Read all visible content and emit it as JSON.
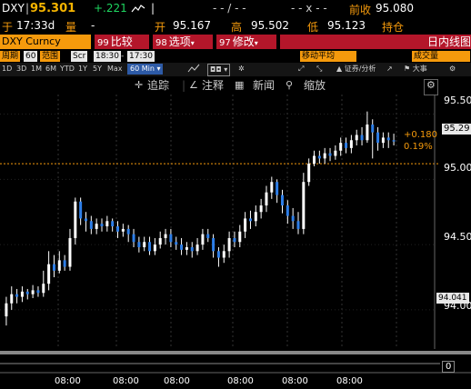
{
  "ticker": {
    "symbol": "DXY",
    "last": "95.301",
    "change": "+.221",
    "bid_ask": "- - / - -",
    "ask_x": "- -  x - -",
    "prev_close_label": "前收",
    "prev_close": "95.080",
    "time_label": "于",
    "time": "17:33d",
    "volume_label": "量",
    "volume": "-",
    "open_label": "开",
    "open": "95.167",
    "high_label": "高",
    "high": "95.502",
    "low_label": "低",
    "low": "95.123",
    "position_label": "持仓"
  },
  "function_bar": {
    "security": "DXY Curncy",
    "compare_num": "99",
    "compare": "比较",
    "options_num": "98",
    "options": "选项",
    "modify_num": "97",
    "modify": "修改",
    "chart_type": "日内线图"
  },
  "period_bar": {
    "period_label": "周期",
    "period_value": "60",
    "range_label": "范围",
    "scr": "Scr",
    "from_time": "18:30",
    "to_time": "17:30",
    "ma_label": "移动平均",
    "volume_label": "成交量"
  },
  "toolbar": {
    "ranges": [
      "1D",
      "3D",
      "1M",
      "6M",
      "YTD",
      "1Y",
      "5Y",
      "Max"
    ],
    "interval": "60 Min",
    "securities_label": "证券/分析",
    "events_label": "大事"
  },
  "annotations": {
    "trend": "追踪",
    "note": "注释",
    "news": "新闻",
    "zoom": "缩放"
  },
  "chart_data": {
    "type": "candlestick",
    "y_ticks": [
      "95.50",
      "95.00",
      "94.50",
      "94.00"
    ],
    "ylim": [
      93.7,
      95.65
    ],
    "x_ticks": [
      "08:00",
      "08:00",
      "08:00",
      "08:00",
      "08:00",
      "08:00"
    ],
    "last_price": "95.29",
    "change_abs": "+0.180",
    "change_pct": "0.19%",
    "prev_close_line": 95.12,
    "low_marker": "94.041",
    "volume_panel_value": "0",
    "candles": [
      [
        93.95,
        94.05,
        93.88,
        94.1
      ],
      [
        94.05,
        94.12,
        94.0,
        94.18
      ],
      [
        94.12,
        94.1,
        94.05,
        94.16
      ],
      [
        94.1,
        94.14,
        94.06,
        94.18
      ],
      [
        94.14,
        94.12,
        94.08,
        94.16
      ],
      [
        94.12,
        94.15,
        94.09,
        94.19
      ],
      [
        94.15,
        94.13,
        94.1,
        94.18
      ],
      [
        94.13,
        94.2,
        94.1,
        94.3
      ],
      [
        94.2,
        94.35,
        94.15,
        94.45
      ],
      [
        94.35,
        94.3,
        94.25,
        94.42
      ],
      [
        94.3,
        94.38,
        94.28,
        94.45
      ],
      [
        94.38,
        94.33,
        94.3,
        94.42
      ],
      [
        94.33,
        94.55,
        94.3,
        94.62
      ],
      [
        94.55,
        94.83,
        94.5,
        94.86
      ],
      [
        94.83,
        94.7,
        94.65,
        94.86
      ],
      [
        94.7,
        94.68,
        94.6,
        94.75
      ],
      [
        94.68,
        94.62,
        94.58,
        94.72
      ],
      [
        94.62,
        94.66,
        94.58,
        94.7
      ],
      [
        94.66,
        94.64,
        94.6,
        94.7
      ],
      [
        94.64,
        94.68,
        94.6,
        94.72
      ],
      [
        94.68,
        94.64,
        94.6,
        94.7
      ],
      [
        94.64,
        94.6,
        94.55,
        94.68
      ],
      [
        94.6,
        94.62,
        94.56,
        94.66
      ],
      [
        94.62,
        94.58,
        94.52,
        94.65
      ],
      [
        94.58,
        94.52,
        94.48,
        94.62
      ],
      [
        94.52,
        94.48,
        94.44,
        94.56
      ],
      [
        94.48,
        94.52,
        94.45,
        94.56
      ],
      [
        94.52,
        94.45,
        94.42,
        94.56
      ],
      [
        94.45,
        94.5,
        94.42,
        94.55
      ],
      [
        94.5,
        94.55,
        94.47,
        94.6
      ],
      [
        94.55,
        94.58,
        94.5,
        94.62
      ],
      [
        94.58,
        94.52,
        94.48,
        94.62
      ],
      [
        94.52,
        94.5,
        94.46,
        94.56
      ],
      [
        94.5,
        94.46,
        94.42,
        94.55
      ],
      [
        94.46,
        94.48,
        94.42,
        94.52
      ],
      [
        94.48,
        94.45,
        94.4,
        94.52
      ],
      [
        94.45,
        94.5,
        94.42,
        94.55
      ],
      [
        94.5,
        94.58,
        94.46,
        94.62
      ],
      [
        94.58,
        94.55,
        94.52,
        94.62
      ],
      [
        94.55,
        94.45,
        94.4,
        94.58
      ],
      [
        94.45,
        94.4,
        94.33,
        94.48
      ],
      [
        94.4,
        94.45,
        94.36,
        94.5
      ],
      [
        94.45,
        94.55,
        94.4,
        94.6
      ],
      [
        94.55,
        94.52,
        94.48,
        94.6
      ],
      [
        94.52,
        94.6,
        94.48,
        94.65
      ],
      [
        94.6,
        94.7,
        94.55,
        94.75
      ],
      [
        94.7,
        94.68,
        94.62,
        94.76
      ],
      [
        94.68,
        94.75,
        94.64,
        94.8
      ],
      [
        94.75,
        94.8,
        94.7,
        94.85
      ],
      [
        94.8,
        94.9,
        94.75,
        94.95
      ],
      [
        94.9,
        94.98,
        94.85,
        95.02
      ],
      [
        94.98,
        94.88,
        94.82,
        95.0
      ],
      [
        94.88,
        94.8,
        94.74,
        94.92
      ],
      [
        94.8,
        94.72,
        94.66,
        94.84
      ],
      [
        94.72,
        94.68,
        94.62,
        94.78
      ],
      [
        94.68,
        94.62,
        94.58,
        94.75
      ],
      [
        94.62,
        94.98,
        94.58,
        95.05
      ],
      [
        94.98,
        95.12,
        94.95,
        95.16
      ],
      [
        95.12,
        95.18,
        95.1,
        95.22
      ],
      [
        95.18,
        95.16,
        95.12,
        95.22
      ],
      [
        95.16,
        95.2,
        95.12,
        95.24
      ],
      [
        95.2,
        95.18,
        95.14,
        95.24
      ],
      [
        95.18,
        95.22,
        95.15,
        95.26
      ],
      [
        95.22,
        95.28,
        95.18,
        95.32
      ],
      [
        95.28,
        95.24,
        95.2,
        95.32
      ],
      [
        95.24,
        95.3,
        95.2,
        95.34
      ],
      [
        95.3,
        95.34,
        95.26,
        95.38
      ],
      [
        95.34,
        95.3,
        95.26,
        95.4
      ],
      [
        95.3,
        95.42,
        95.28,
        95.52
      ],
      [
        95.42,
        95.36,
        95.16,
        95.46
      ],
      [
        95.36,
        95.28,
        95.22,
        95.4
      ],
      [
        95.28,
        95.32,
        95.24,
        95.36
      ],
      [
        95.32,
        95.3,
        95.24,
        95.36
      ],
      [
        95.3,
        95.29,
        95.26,
        95.35
      ]
    ]
  }
}
